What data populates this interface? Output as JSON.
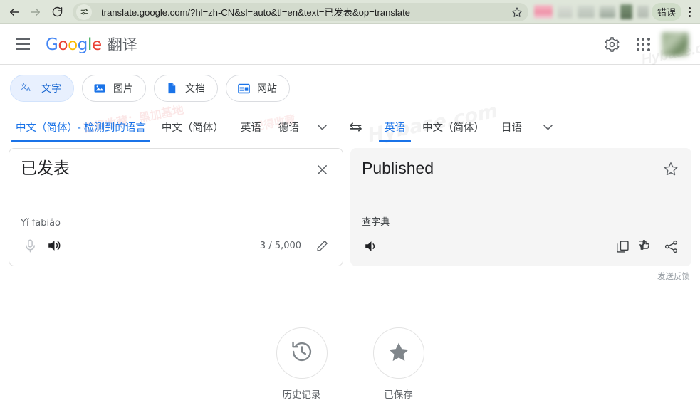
{
  "browser": {
    "url": "translate.google.com/?hl=zh-CN&sl=auto&tl=en&text=已发表&op=translate",
    "back_title": "返回",
    "forward_title": "前进",
    "reload_title": "重新加载",
    "site_info_title": "查看站点信息",
    "bookmark_title": "为此标签页添加书签",
    "error_chip_label": "错误",
    "menu_title": "自定义及控制 Google Chrome"
  },
  "header": {
    "menu_label": "主菜单",
    "logo_letters": [
      "G",
      "o",
      "o",
      "g",
      "l",
      "e"
    ],
    "product_name": "翻译",
    "settings_title": "设置",
    "apps_title": "Google 应用",
    "account_title": "Google 账号"
  },
  "mode_tabs": [
    {
      "label": "文字",
      "icon": "text-translate-icon",
      "active": true
    },
    {
      "label": "图片",
      "icon": "image-icon",
      "active": false
    },
    {
      "label": "文档",
      "icon": "document-icon",
      "active": false
    },
    {
      "label": "网站",
      "icon": "website-icon",
      "active": false
    }
  ],
  "source_languages": [
    {
      "label": "中文（简体）- 检测到的语言",
      "active": true
    },
    {
      "label": "中文（简体）",
      "active": false
    },
    {
      "label": "英语",
      "active": false
    },
    {
      "label": "德语",
      "active": false
    }
  ],
  "target_languages": [
    {
      "label": "英语",
      "active": true
    },
    {
      "label": "中文（简体）",
      "active": false
    },
    {
      "label": "日语",
      "active": false
    }
  ],
  "swap_title": "互换语言",
  "more_languages_title": "更多语言",
  "source_panel": {
    "text": "已发表",
    "romanization": "Yǐ fābiǎo",
    "char_count": "3 / 5,000",
    "clear_title": "清空源文本",
    "mic_title": "语音输入",
    "listen_title": "朗读源文本",
    "handwrite_title": "手写输入"
  },
  "target_panel": {
    "text": "Published",
    "dictionary_link": "查字典",
    "star_title": "保存翻译",
    "listen_title": "朗读译文",
    "copy_title": "复制译文",
    "rate_title": "为这条译文评分",
    "share_title": "分享译文"
  },
  "feedback_label": "发送反馈",
  "bottom_actions": [
    {
      "label": "历史记录",
      "icon": "history-icon"
    },
    {
      "label": "已保存",
      "icon": "star-filled-icon"
    }
  ],
  "watermarks": {
    "site": "Hybase.com",
    "note1": "记得收藏：黑加基地",
    "note2": "记得收藏",
    "note3": "记得收藏"
  },
  "colors": {
    "accent_blue": "#1a73e8",
    "tab_active_bg": "#e8f0fe",
    "chrome_bg": "#dfe6da",
    "panel_bg": "#f5f5f5",
    "text_primary": "#202124",
    "text_secondary": "#5f6368"
  }
}
